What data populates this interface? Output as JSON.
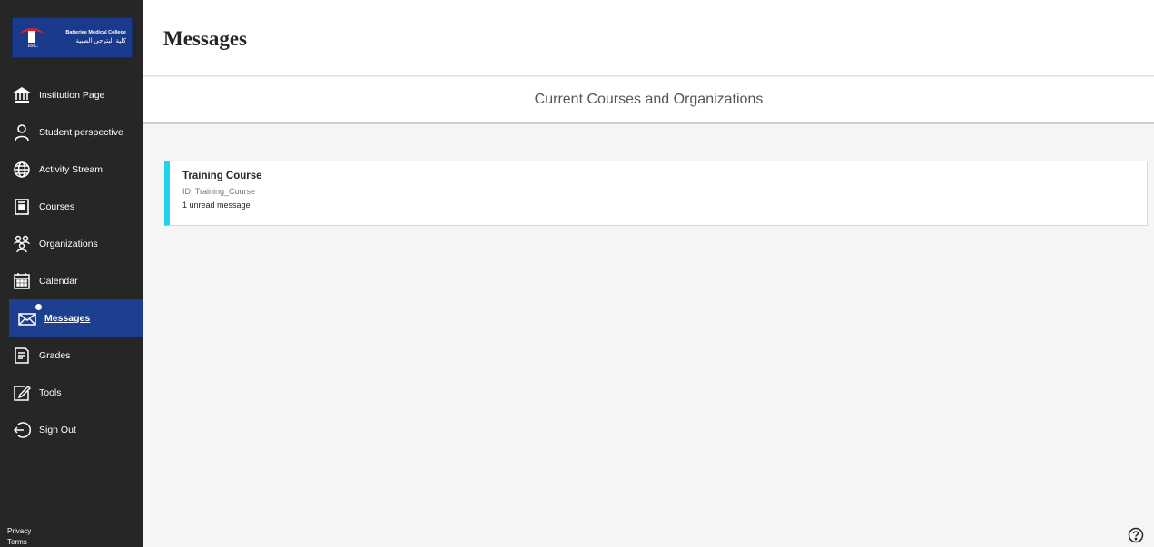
{
  "logo": {
    "name_en": "Batterjee Medical College",
    "name_ar": "كلية البترجي الطبية",
    "abbr": "BMC"
  },
  "sidebar": {
    "items": [
      {
        "label": "Institution Page",
        "icon": "institution-icon"
      },
      {
        "label": "Student perspective",
        "icon": "person-icon"
      },
      {
        "label": "Activity Stream",
        "icon": "globe-icon"
      },
      {
        "label": "Courses",
        "icon": "courses-icon"
      },
      {
        "label": "Organizations",
        "icon": "organizations-icon"
      },
      {
        "label": "Calendar",
        "icon": "calendar-icon"
      },
      {
        "label": "Messages",
        "icon": "envelope-icon",
        "active": true
      },
      {
        "label": "Grades",
        "icon": "grades-icon"
      },
      {
        "label": "Tools",
        "icon": "tools-icon"
      },
      {
        "label": "Sign Out",
        "icon": "sign-out-icon"
      }
    ],
    "footer": {
      "privacy": "Privacy",
      "terms": "Terms"
    }
  },
  "header": {
    "title": "Messages"
  },
  "section": {
    "title": "Current Courses and Organizations"
  },
  "courses": [
    {
      "name": "Training Course",
      "id": "ID: Training_Course",
      "unread": "1 unread message"
    }
  ],
  "colors": {
    "sidebar_bg": "#262626",
    "active_bg": "#1d3f8f",
    "card_accent": "#1fd2f2",
    "main_bg": "#f5f5f5"
  },
  "help_icon": "help-icon"
}
